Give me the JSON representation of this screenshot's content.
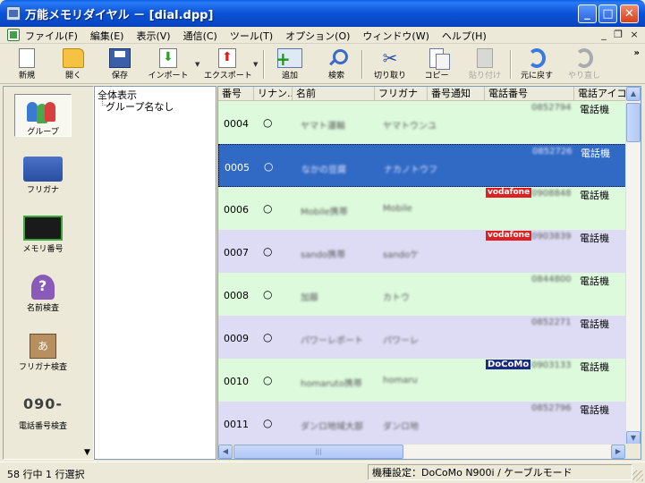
{
  "window": {
    "title": "万能メモリダイヤル － [dial.dpp]",
    "controls": {
      "minimize": "_",
      "maximize": "□",
      "close": "✕"
    }
  },
  "menu": {
    "items": [
      "ファイル(F)",
      "編集(E)",
      "表示(V)",
      "通信(C)",
      "ツール(T)",
      "オプション(O)",
      "ウィンドウ(W)",
      "ヘルプ(H)"
    ],
    "mdi_minimize": "_",
    "mdi_restore": "❐",
    "mdi_close": "×"
  },
  "toolbar": {
    "new": "新規",
    "open": "開く",
    "save": "保存",
    "import": "インポート",
    "export": "エクスポート",
    "add": "追加",
    "search": "検索",
    "cut": "切り取り",
    "copy": "コピー",
    "paste": "貼り付け",
    "undo": "元に戻す",
    "redo": "やり直し",
    "overflow": "»",
    "dropdown": "▼"
  },
  "left_panel": {
    "items": [
      {
        "label": "グループ",
        "icon": "group-icon",
        "active": true
      },
      {
        "label": "フリガナ",
        "icon": "furigana-icon"
      },
      {
        "label": "メモリ番号",
        "icon": "memory-number-icon"
      },
      {
        "label": "名前検査",
        "icon": "name-check-icon"
      },
      {
        "label": "フリガナ検査",
        "icon": "kana-check-icon"
      },
      {
        "label": "電話番号検査",
        "icon": "phone-check-icon"
      }
    ],
    "phone_icon_text": "090-",
    "scroll_down": "▼"
  },
  "tree": {
    "root": "全体表示",
    "child": "グループ名なし"
  },
  "list": {
    "columns": [
      "番号",
      "リナン...",
      "名前",
      "フリガナ",
      "番号通知",
      "電話番号",
      "電話アイコン"
    ],
    "rows": [
      {
        "num": "0004",
        "rin": "○",
        "name": "ヤマト運輸",
        "kana": "ヤマトウンユ",
        "badge": "",
        "phone": "0852794",
        "icon": "電話機",
        "color": "green"
      },
      {
        "num": "0005",
        "rin": "○",
        "name": "なかの豆腐",
        "kana": "ナカノトウフ",
        "badge": "",
        "phone": "0852726",
        "icon": "電話機",
        "color": "sel"
      },
      {
        "num": "0006",
        "rin": "○",
        "name": "Mobile携帯",
        "kana": "Mobile",
        "badge": "vodafone",
        "phone": "0908848",
        "icon": "電話機",
        "color": "green"
      },
      {
        "num": "0007",
        "rin": "○",
        "name": "sando携帯",
        "kana": "sandoケ",
        "badge": "vodafone",
        "phone": "0903839",
        "icon": "電話機",
        "color": "lav"
      },
      {
        "num": "0008",
        "rin": "○",
        "name": "加藤",
        "kana": "カトウ",
        "badge": "",
        "phone": "0844800",
        "icon": "電話機",
        "color": "green"
      },
      {
        "num": "0009",
        "rin": "○",
        "name": "パワーレポート",
        "kana": "パワーレ",
        "badge": "",
        "phone": "0852271",
        "icon": "電話機",
        "color": "lav"
      },
      {
        "num": "0010",
        "rin": "○",
        "name": "homaruto携帯",
        "kana": "homaru",
        "badge": "DoCoMo",
        "phone": "0903133",
        "icon": "電話機",
        "color": "green"
      },
      {
        "num": "0011",
        "rin": "○",
        "name": "ダンロ地域大部",
        "kana": "ダンロ地",
        "badge": "",
        "phone": "0852796",
        "icon": "電話機",
        "color": "lav"
      }
    ],
    "scroll_up": "▲",
    "scroll_down": "▼",
    "scroll_left": "◀",
    "scroll_right": "▶",
    "thumb_grip": "|||"
  },
  "status": {
    "left": "58 行中 1 行選択",
    "right": "機種設定：DoCoMo N900i / ケーブルモード"
  }
}
